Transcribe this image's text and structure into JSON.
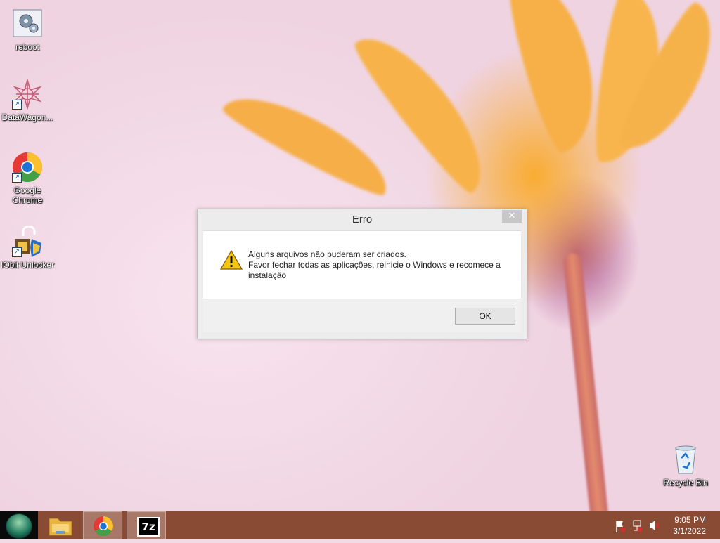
{
  "desktop": {
    "icons": [
      {
        "label": "reboot",
        "icon": "gears-icon"
      },
      {
        "label": "DataWagon...",
        "icon": "datawagon-icon"
      },
      {
        "label": "Google Chrome",
        "icon": "chrome-icon"
      },
      {
        "label": "IObit Unlocker",
        "icon": "unlocker-icon"
      },
      {
        "label": "Recycle Bin",
        "icon": "recycle-bin-icon"
      }
    ]
  },
  "dialog": {
    "title": "Erro",
    "close_glyph": "✕",
    "line1": "Alguns arquivos não puderam ser criados.",
    "line2": "Favor fechar todas as aplicações, reinicie o Windows e recomece a instalação",
    "ok_label": "OK"
  },
  "taskbar": {
    "apps": [
      "file-explorer",
      "google-chrome",
      "7-zip"
    ],
    "clock_time": "9:05 PM",
    "clock_date": "3/1/2022",
    "sevenzip_label": "7z"
  }
}
